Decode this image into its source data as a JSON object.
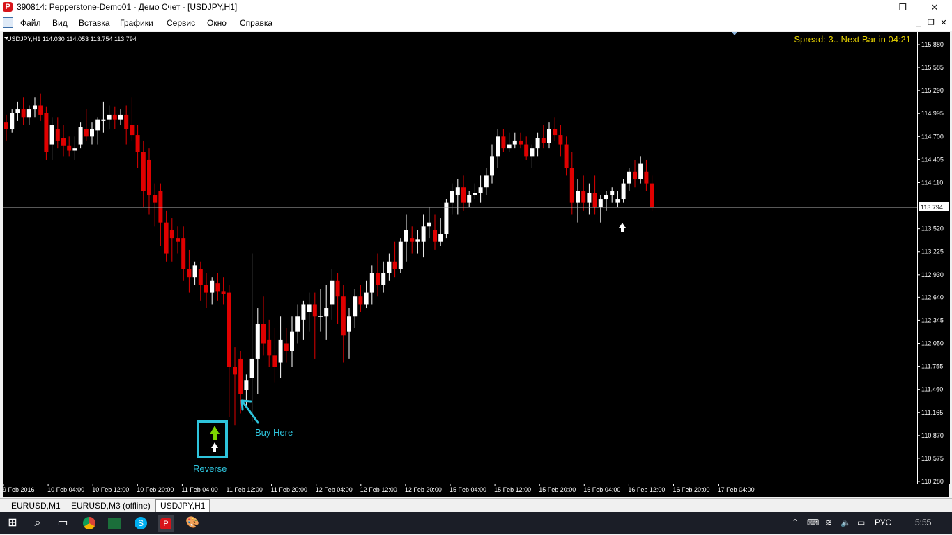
{
  "window": {
    "title": "390814: Pepperstone-Demo01 - Демо Счет - [USDJPY,H1]"
  },
  "menu": {
    "items": [
      "Файл",
      "Вид",
      "Вставка",
      "Графики",
      "Сервис",
      "Окно",
      "Справка"
    ]
  },
  "chart": {
    "header": "USDJPY,H1  114.030 114.053 113.754 113.794",
    "info": "Spread: 3.. Next Bar in 04:21",
    "current_price": "113.794",
    "annotation_buy": "Buy Here",
    "annotation_reverse": "Reverse",
    "colors": {
      "bull": "#ffffff",
      "bear": "#e00000",
      "info": "#e6d200",
      "annotation": "#2ec4dc",
      "arrow": "#7ed600"
    }
  },
  "chart_data": {
    "type": "candlestick",
    "price_ticks": [
      "115.880",
      "115.585",
      "115.290",
      "114.995",
      "114.700",
      "114.405",
      "114.110",
      "113.520",
      "113.225",
      "112.930",
      "112.640",
      "112.345",
      "112.050",
      "111.755",
      "111.460",
      "111.165",
      "110.870",
      "110.575",
      "110.280"
    ],
    "ylim": [
      110.28,
      115.88
    ],
    "time_ticks": [
      "9 Feb 2016",
      "10 Feb 04:00",
      "10 Feb 12:00",
      "10 Feb 20:00",
      "11 Feb 04:00",
      "11 Feb 12:00",
      "11 Feb 20:00",
      "12 Feb 04:00",
      "12 Feb 12:00",
      "12 Feb 20:00",
      "15 Feb 04:00",
      "15 Feb 12:00",
      "15 Feb 20:00",
      "16 Feb 04:00",
      "16 Feb 12:00",
      "16 Feb 20:00",
      "17 Feb 04:00"
    ],
    "candles": [
      [
        114.88,
        114.98,
        114.65,
        114.8
      ],
      [
        114.8,
        115.05,
        114.75,
        115.0
      ],
      [
        115.0,
        115.15,
        114.9,
        115.05
      ],
      [
        115.05,
        115.2,
        114.85,
        114.95
      ],
      [
        114.95,
        115.1,
        114.85,
        115.05
      ],
      [
        115.05,
        115.2,
        114.95,
        115.1
      ],
      [
        115.1,
        115.25,
        114.9,
        114.98
      ],
      [
        115.0,
        115.08,
        114.4,
        114.5
      ],
      [
        114.6,
        114.95,
        114.4,
        114.85
      ],
      [
        114.8,
        114.95,
        114.55,
        114.65
      ],
      [
        114.68,
        114.85,
        114.45,
        114.58
      ],
      [
        114.58,
        114.7,
        114.45,
        114.52
      ],
      [
        114.52,
        114.7,
        114.4,
        114.55
      ],
      [
        114.6,
        114.88,
        114.55,
        114.82
      ],
      [
        114.8,
        115.05,
        114.65,
        114.7
      ],
      [
        114.7,
        114.88,
        114.6,
        114.8
      ],
      [
        114.78,
        114.95,
        114.6,
        114.92
      ],
      [
        114.9,
        115.15,
        114.75,
        114.92
      ],
      [
        114.92,
        115.1,
        114.8,
        114.98
      ],
      [
        114.98,
        115.08,
        114.8,
        114.92
      ],
      [
        114.92,
        115.05,
        114.85,
        114.98
      ],
      [
        114.98,
        115.1,
        114.6,
        114.8
      ],
      [
        114.85,
        115.2,
        114.65,
        114.72
      ],
      [
        114.72,
        114.85,
        114.3,
        114.5
      ],
      [
        114.5,
        114.65,
        113.8,
        114.0
      ],
      [
        114.4,
        114.55,
        113.7,
        113.95
      ],
      [
        113.95,
        114.1,
        113.55,
        113.85
      ],
      [
        114.0,
        114.1,
        113.3,
        113.6
      ],
      [
        113.6,
        113.75,
        113.1,
        113.2
      ],
      [
        113.5,
        113.65,
        113.1,
        113.4
      ],
      [
        113.4,
        113.55,
        113.2,
        113.35
      ],
      [
        113.4,
        113.55,
        112.85,
        113.0
      ],
      [
        113.0,
        113.25,
        112.7,
        112.9
      ],
      [
        112.9,
        113.1,
        112.8,
        113.05
      ],
      [
        113.0,
        113.1,
        112.6,
        112.8
      ],
      [
        112.8,
        112.95,
        112.5,
        112.7
      ],
      [
        112.7,
        112.9,
        112.55,
        112.85
      ],
      [
        112.82,
        112.95,
        112.6,
        112.72
      ],
      [
        112.72,
        112.9,
        112.55,
        112.68
      ],
      [
        112.7,
        112.8,
        111.1,
        111.75
      ],
      [
        111.75,
        112.0,
        111.0,
        111.65
      ],
      [
        111.85,
        111.95,
        111.15,
        111.4
      ],
      [
        111.45,
        111.65,
        111.25,
        111.58
      ],
      [
        111.6,
        113.2,
        111.05,
        111.85
      ],
      [
        111.85,
        112.5,
        111.4,
        112.3
      ],
      [
        112.3,
        112.65,
        111.9,
        112.05
      ],
      [
        112.1,
        112.35,
        111.75,
        111.9
      ],
      [
        111.9,
        112.25,
        111.55,
        111.75
      ],
      [
        111.8,
        112.4,
        111.6,
        112.1
      ],
      [
        112.05,
        112.25,
        111.8,
        111.95
      ],
      [
        111.95,
        112.4,
        111.75,
        112.2
      ],
      [
        112.2,
        112.55,
        112.05,
        112.4
      ],
      [
        112.35,
        112.6,
        112.1,
        112.55
      ],
      [
        112.45,
        112.7,
        112.2,
        112.55
      ],
      [
        112.55,
        112.7,
        111.85,
        112.4
      ],
      [
        112.4,
        112.75,
        112.2,
        112.4
      ],
      [
        112.4,
        112.8,
        112.1,
        112.5
      ],
      [
        112.55,
        113.0,
        112.35,
        112.85
      ],
      [
        112.85,
        112.95,
        112.3,
        112.65
      ],
      [
        112.65,
        112.8,
        111.8,
        112.15
      ],
      [
        112.2,
        112.5,
        111.85,
        112.4
      ],
      [
        112.4,
        112.75,
        112.25,
        112.65
      ],
      [
        112.65,
        112.8,
        112.45,
        112.55
      ],
      [
        112.55,
        112.85,
        112.5,
        112.7
      ],
      [
        112.7,
        113.05,
        112.55,
        112.95
      ],
      [
        112.95,
        113.2,
        112.65,
        112.8
      ],
      [
        112.8,
        113.1,
        112.7,
        112.95
      ],
      [
        112.95,
        113.2,
        112.85,
        113.1
      ],
      [
        113.1,
        113.35,
        112.9,
        113.0
      ],
      [
        113.0,
        113.4,
        112.95,
        113.35
      ],
      [
        113.35,
        113.7,
        113.1,
        113.5
      ],
      [
        113.4,
        113.55,
        113.2,
        113.35
      ],
      [
        113.35,
        113.5,
        113.2,
        113.38
      ],
      [
        113.35,
        113.7,
        113.15,
        113.55
      ],
      [
        113.55,
        113.8,
        113.4,
        113.6
      ],
      [
        113.5,
        113.7,
        113.25,
        113.35
      ],
      [
        113.35,
        113.65,
        113.3,
        113.45
      ],
      [
        113.45,
        113.9,
        113.4,
        113.85
      ],
      [
        113.85,
        114.1,
        113.7,
        114.0
      ],
      [
        113.95,
        114.15,
        113.7,
        114.05
      ],
      [
        114.05,
        114.2,
        113.75,
        113.85
      ],
      [
        113.85,
        114.0,
        113.8,
        113.95
      ],
      [
        113.95,
        114.1,
        113.9,
        113.98
      ],
      [
        113.98,
        114.2,
        113.85,
        114.05
      ],
      [
        114.05,
        114.3,
        113.95,
        114.2
      ],
      [
        114.2,
        114.6,
        114.1,
        114.45
      ],
      [
        114.45,
        114.8,
        114.3,
        114.7
      ],
      [
        114.7,
        114.8,
        114.5,
        114.55
      ],
      [
        114.55,
        114.75,
        114.5,
        114.6
      ],
      [
        114.6,
        114.75,
        114.55,
        114.65
      ],
      [
        114.65,
        114.75,
        114.55,
        114.6
      ],
      [
        114.6,
        114.7,
        114.4,
        114.45
      ],
      [
        114.45,
        114.6,
        114.3,
        114.55
      ],
      [
        114.55,
        114.75,
        114.45,
        114.68
      ],
      [
        114.68,
        114.85,
        114.55,
        114.62
      ],
      [
        114.62,
        114.88,
        114.55,
        114.8
      ],
      [
        114.8,
        114.95,
        114.65,
        114.72
      ],
      [
        114.72,
        114.85,
        114.45,
        114.6
      ],
      [
        114.6,
        114.7,
        114.2,
        114.3
      ],
      [
        114.3,
        114.5,
        113.7,
        113.85
      ],
      [
        113.85,
        114.15,
        113.6,
        114.0
      ],
      [
        114.0,
        114.2,
        113.75,
        113.85
      ],
      [
        113.85,
        114.1,
        113.7,
        113.98
      ],
      [
        113.98,
        114.2,
        113.7,
        113.8
      ],
      [
        113.8,
        113.95,
        113.6,
        113.9
      ],
      [
        113.9,
        114.0,
        113.75,
        113.95
      ],
      [
        113.95,
        114.05,
        113.85,
        114.0
      ],
      [
        113.85,
        114.0,
        113.8,
        113.9
      ],
      [
        113.9,
        114.15,
        113.85,
        114.1
      ],
      [
        114.1,
        114.3,
        114.0,
        114.25
      ],
      [
        114.25,
        114.4,
        114.05,
        114.15
      ],
      [
        114.15,
        114.45,
        114.1,
        114.35
      ],
      [
        114.25,
        114.4,
        114.0,
        114.1
      ],
      [
        114.1,
        114.2,
        113.75,
        113.8
      ]
    ]
  },
  "tabs": [
    "EURUSD,M1",
    "EURUSD,M3 (offline)",
    "USDJPY,H1"
  ],
  "taskbar": {
    "lang": "РУС",
    "time": "5:55"
  }
}
